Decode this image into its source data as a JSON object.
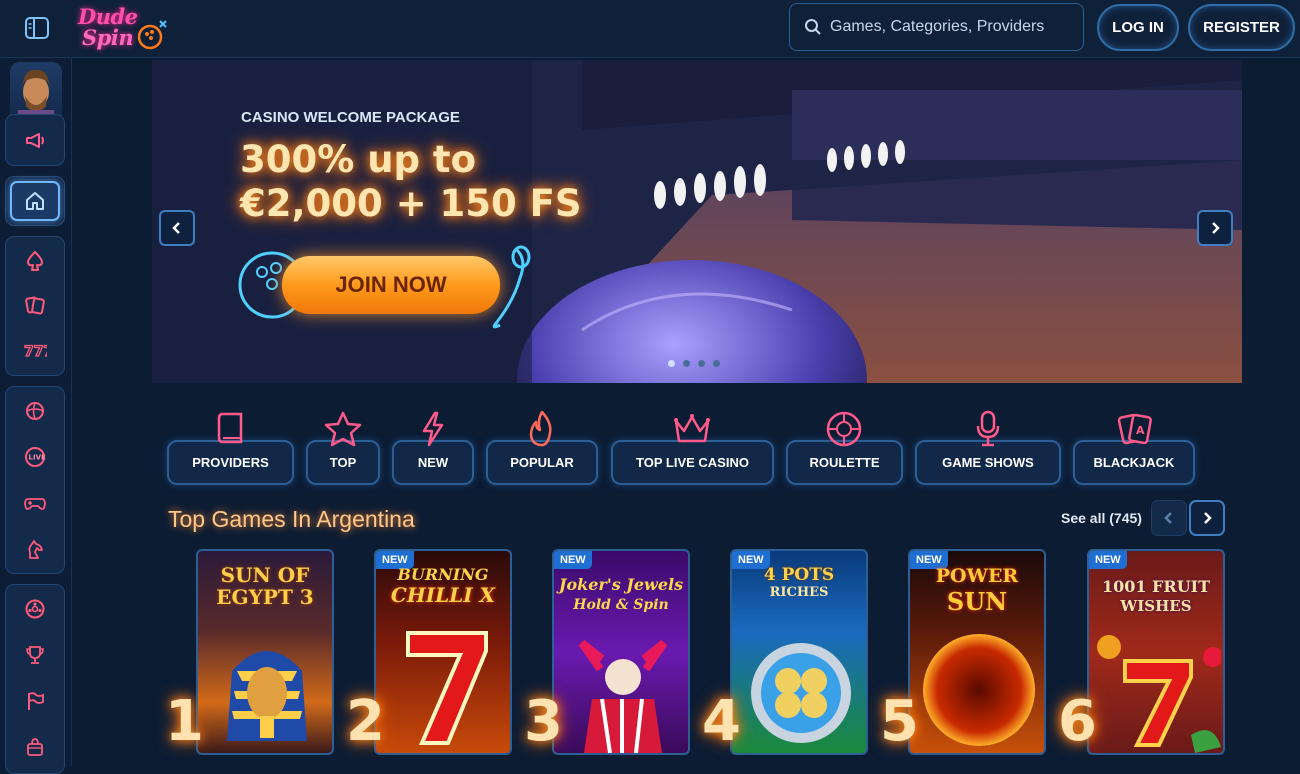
{
  "header": {
    "logo_line1": "Dude",
    "logo_line2": "Spin",
    "search_placeholder": "Games, Categories, Providers",
    "login_label": "LOG IN",
    "register_label": "REGISTER"
  },
  "banner": {
    "pretitle": "CASINO WELCOME PACKAGE",
    "title_line1": "300% up to",
    "title_line2": "€2,000 + 150 FS",
    "cta_label": "JOIN NOW",
    "slide_count": 4,
    "active_slide": 1
  },
  "categories": [
    {
      "label": "PROVIDERS",
      "icon": "book-icon"
    },
    {
      "label": "TOP",
      "icon": "star-icon"
    },
    {
      "label": "NEW",
      "icon": "lightning-icon"
    },
    {
      "label": "POPULAR",
      "icon": "flame-icon"
    },
    {
      "label": "TOP LIVE CASINO",
      "icon": "crown-icon"
    },
    {
      "label": "ROULETTE",
      "icon": "roulette-icon"
    },
    {
      "label": "GAME SHOWS",
      "icon": "microphone-icon"
    },
    {
      "label": "BLACKJACK",
      "icon": "cards-icon"
    }
  ],
  "top_games": {
    "title": "Top Games In Argentina",
    "see_all": "See all (745)",
    "games": [
      {
        "rank": "1",
        "name_line1": "SUN OF",
        "name_line2": "EGYPT 3",
        "new": false,
        "badge": ""
      },
      {
        "rank": "2",
        "name_line1": "BURNING",
        "name_line2": "CHILLI X",
        "new": true,
        "badge": "NEW"
      },
      {
        "rank": "3",
        "name_line1": "Joker's Jewels",
        "name_line2": "Hold & Spin",
        "new": true,
        "badge": "NEW"
      },
      {
        "rank": "4",
        "name_line1": "4 POTS",
        "name_line2": "RICHES",
        "new": true,
        "badge": "NEW"
      },
      {
        "rank": "5",
        "name_line1": "POWER",
        "name_line2": "SUN",
        "new": true,
        "badge": "NEW"
      },
      {
        "rank": "6",
        "name_line1": "1001 FRUIT",
        "name_line2": "WISHES",
        "new": true,
        "badge": "NEW"
      }
    ]
  },
  "colors": {
    "background": "#0c1c33",
    "accent_blue": "#2b5f96",
    "neon_orange": "#ff8a1f",
    "neon_pink": "#ff4fae"
  }
}
